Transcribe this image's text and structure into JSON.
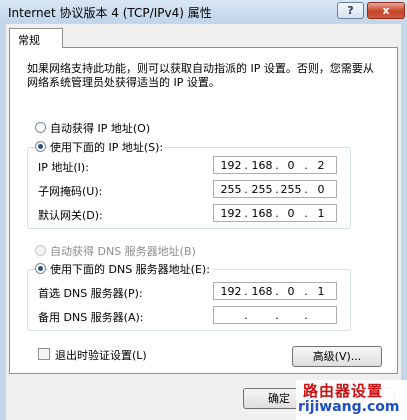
{
  "window": {
    "title": "Internet 协议版本 4 (TCP/IPv4) 属性",
    "help_label": "?",
    "close_label": "x"
  },
  "tab": {
    "label": "常规"
  },
  "description": "如果网络支持此功能，则可以获取自动指派的 IP 设置。否则，您需要从网络系统管理员处获得适当的 IP 设置。",
  "ip_section": {
    "auto_label": "自动获得 IP 地址(O)",
    "auto_selected": false,
    "manual_label": "使用下面的 IP 地址(S):",
    "manual_selected": true,
    "fields": [
      {
        "label": "IP 地址(I):",
        "octets": [
          "192",
          "168",
          "0",
          "2"
        ]
      },
      {
        "label": "子网掩码(U):",
        "octets": [
          "255",
          "255",
          "255",
          "0"
        ]
      },
      {
        "label": "默认网关(D):",
        "octets": [
          "192",
          "168",
          "0",
          "1"
        ]
      }
    ]
  },
  "dns_section": {
    "auto_label": "自动获得 DNS 服务器地址(B)",
    "auto_selected": false,
    "auto_disabled": true,
    "manual_label": "使用下面的 DNS 服务器地址(E):",
    "manual_selected": true,
    "fields": [
      {
        "label": "首选 DNS 服务器(P):",
        "octets": [
          "192",
          "168",
          "0",
          "1"
        ]
      },
      {
        "label": "备用 DNS 服务器(A):",
        "octets": [
          "",
          "",
          "",
          ""
        ]
      }
    ]
  },
  "validate_on_exit": {
    "label": "退出时验证设置(L)",
    "checked": false
  },
  "buttons": {
    "advanced_label": "高级(V)...",
    "ok_label": "确定"
  },
  "watermark": {
    "line1": "路由器设置",
    "line2": "rijiwang.com"
  },
  "colors": {
    "title_bar": "#c2d5ea",
    "close_button": "#c7442a",
    "radio_dot": "#2a4f80"
  }
}
